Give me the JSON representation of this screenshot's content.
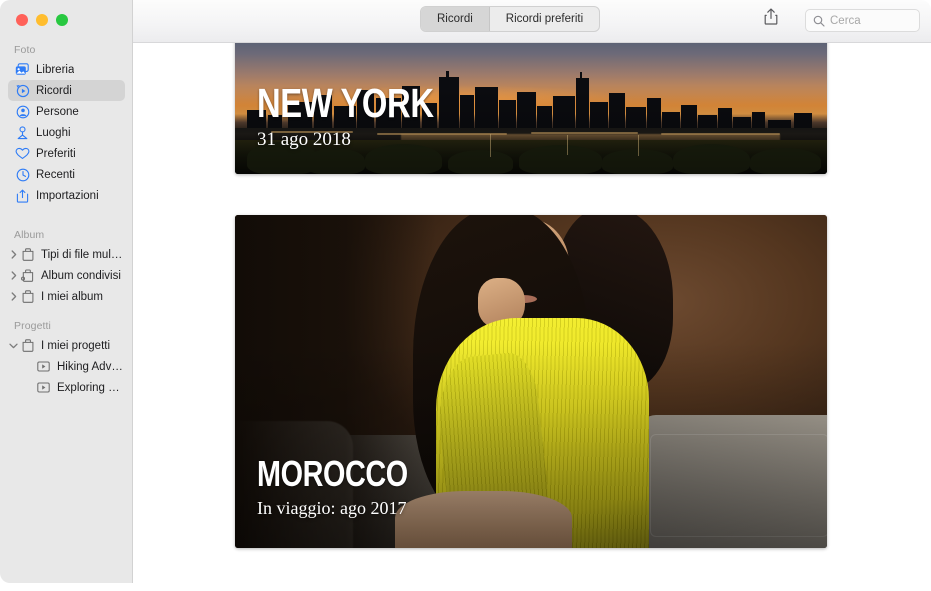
{
  "window": {
    "traffic_lights": [
      {
        "name": "close",
        "color": "#ff6159"
      },
      {
        "name": "minimize",
        "color": "#ffbd2e"
      },
      {
        "name": "zoom",
        "color": "#28c840"
      }
    ]
  },
  "sidebar": {
    "sections": [
      {
        "header": "Foto",
        "items": [
          {
            "label": "Libreria",
            "icon": "photo-stack-icon",
            "selected": false
          },
          {
            "label": "Ricordi",
            "icon": "memories-icon",
            "selected": true
          },
          {
            "label": "Persone",
            "icon": "person-icon",
            "selected": false
          },
          {
            "label": "Luoghi",
            "icon": "map-pin-icon",
            "selected": false
          },
          {
            "label": "Preferiti",
            "icon": "heart-icon",
            "selected": false
          },
          {
            "label": "Recenti",
            "icon": "clock-icon",
            "selected": false
          },
          {
            "label": "Importazioni",
            "icon": "import-icon",
            "selected": false
          }
        ]
      },
      {
        "header": "Album",
        "items": [
          {
            "label": "Tipi di file multi...",
            "icon": "folder-icon",
            "disclosure": "collapsed"
          },
          {
            "label": "Album condivisi",
            "icon": "shared-folder-icon",
            "disclosure": "collapsed"
          },
          {
            "label": "I miei album",
            "icon": "folder-icon",
            "disclosure": "collapsed"
          }
        ]
      },
      {
        "header": "Progetti",
        "items": [
          {
            "label": "I miei progetti",
            "icon": "folder-icon",
            "disclosure": "expanded"
          },
          {
            "label": "Hiking Adve...",
            "icon": "slideshow-icon",
            "child": true
          },
          {
            "label": "Exploring M...",
            "icon": "slideshow-icon",
            "child": true
          }
        ]
      }
    ]
  },
  "toolbar": {
    "segments": [
      {
        "label": "Ricordi",
        "active": true
      },
      {
        "label": "Ricordi preferiti",
        "active": false
      }
    ],
    "share_icon": "share-icon",
    "search": {
      "icon": "search-icon",
      "placeholder": "Cerca",
      "value": ""
    }
  },
  "main": {
    "memories": [
      {
        "id": "new-york",
        "title": "NEW YORK",
        "subtitle": "31 ago 2018",
        "photo": "new-york-skyline-sunset"
      },
      {
        "id": "morocco",
        "title": "MOROCCO",
        "subtitle": "In viaggio: ago 2017",
        "photo": "woman-yellow-sweater-portrait"
      }
    ]
  },
  "colors": {
    "sidebar_bg": "#e8e8e8",
    "selection": "#d4d4d4",
    "accent": "#2f7cf6",
    "content_bg": "#ffffff"
  }
}
